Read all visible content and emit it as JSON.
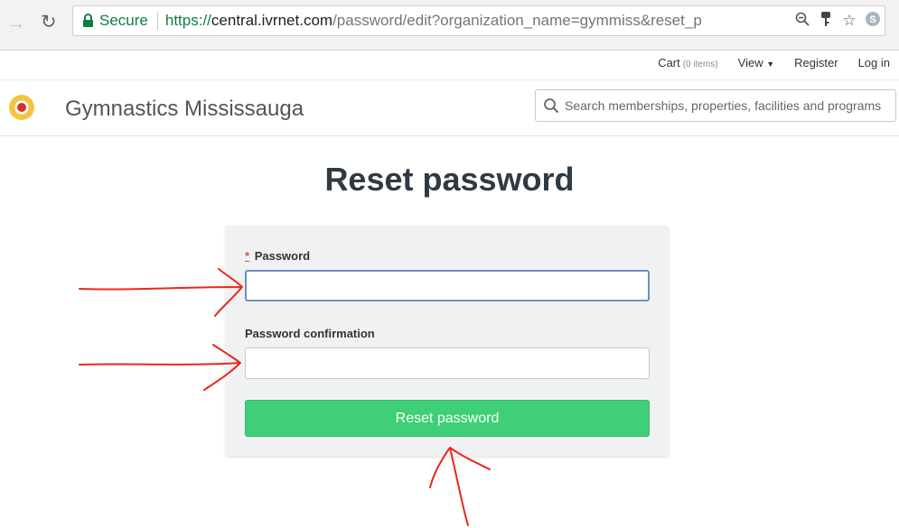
{
  "browser": {
    "secure_label": "Secure",
    "url_scheme": "https://",
    "url_host": "central.ivrnet.com",
    "url_path": "/password/edit?organization_name=gymmiss&reset_p"
  },
  "topnav": {
    "cart_label": "Cart",
    "cart_count": "(0 items)",
    "view_label": "View",
    "register_label": "Register",
    "login_label": "Log in"
  },
  "header": {
    "site_name": "Gymnastics Mississauga",
    "search_placeholder": "Search memberships, properties, facilities and programs"
  },
  "main": {
    "title": "Reset password",
    "form": {
      "password_required_mark": "*",
      "password_label": "Password",
      "password_value": "",
      "confirmation_label": "Password confirmation",
      "confirmation_value": "",
      "submit_label": "Reset password"
    }
  },
  "colors": {
    "secure_green": "#0b8043",
    "submit_green": "#3ecf78",
    "focus_blue": "#6b8fc1",
    "required_red": "#d9534f",
    "annotation_red": "#e8281e"
  }
}
